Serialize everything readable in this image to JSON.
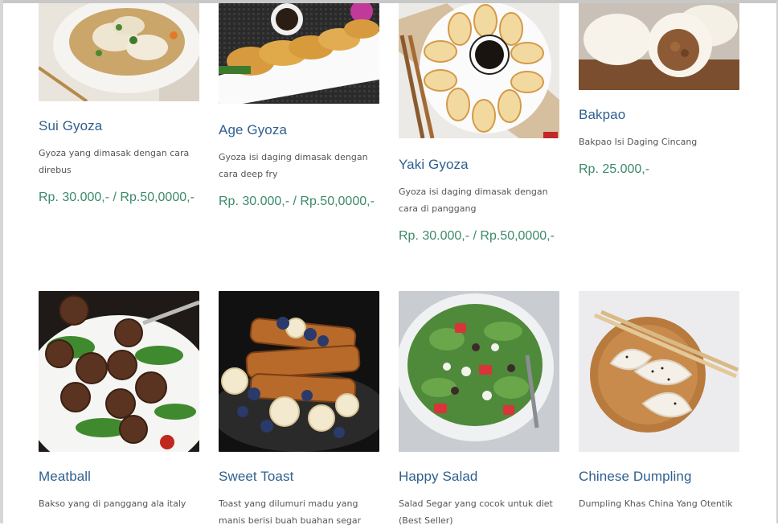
{
  "products": [
    {
      "name": "Sui Gyoza",
      "desc": "Gyoza yang dimasak dengan cara direbus",
      "price": "Rp. 30.000,- / Rp.50,0000,-",
      "image": "dumpling-soup-photo"
    },
    {
      "name": "Age Gyoza",
      "desc": "Gyoza isi daging dimasak dengan cara deep fry",
      "price": "Rp. 30.000,- / Rp.50,0000,-",
      "image": "fried-gyoza-photo"
    },
    {
      "name": "Yaki Gyoza",
      "desc": "Gyoza isi daging dimasak dengan cara di panggang",
      "price": "Rp. 30.000,- / Rp.50,0000,-",
      "image": "grilled-gyoza-photo"
    },
    {
      "name": "Bakpao",
      "desc": "Bakpao Isi Daging Cincang",
      "price": "Rp. 25.000,-",
      "image": "bakpao-photo"
    },
    {
      "name": "Meatball",
      "desc": "Bakso yang di panggang ala italy",
      "price": "",
      "image": "meatball-photo"
    },
    {
      "name": "Sweet Toast",
      "desc": "Toast yang dilumuri madu yang manis berisi buah buahan segar",
      "price": "",
      "image": "sweet-toast-photo"
    },
    {
      "name": "Happy Salad",
      "desc": "Salad Segar yang cocok untuk diet (Best Seller)",
      "price": "",
      "image": "salad-photo"
    },
    {
      "name": "Chinese Dumpling",
      "desc": "Dumpling Khas China Yang Otentik",
      "price": "",
      "image": "chinese-dumpling-photo"
    }
  ],
  "colors": {
    "title": "#2f5f8e",
    "price": "#3c8a6a",
    "desc": "#555555"
  }
}
